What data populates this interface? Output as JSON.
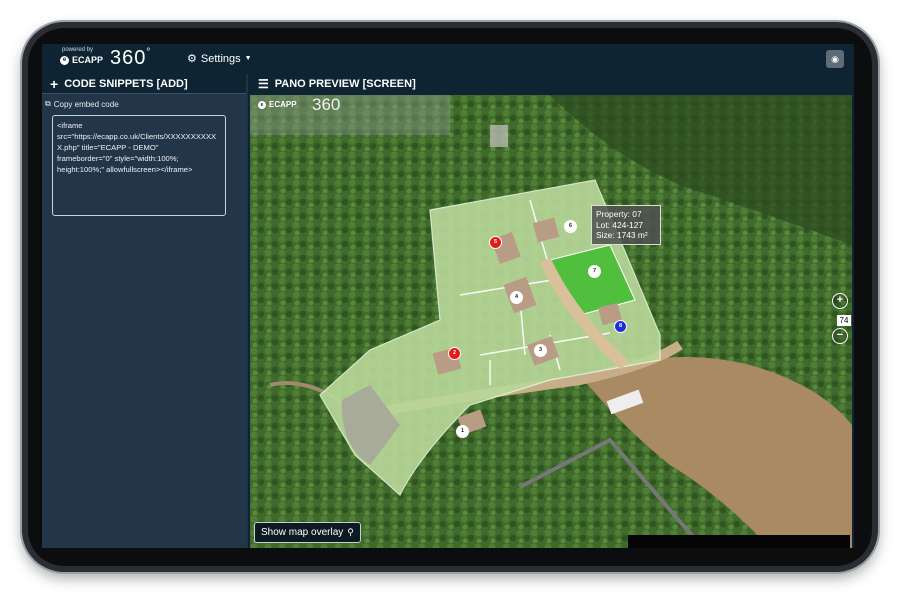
{
  "header": {
    "powered_by": "powered by",
    "brand": "ECAPP",
    "logo_text": "360",
    "logo_degree": "°",
    "settings_label": "Settings",
    "colors": {
      "bar": "#0e2433",
      "panel": "#233549"
    }
  },
  "left_panel": {
    "title": "CODE SNIPPETS [ADD]",
    "copy_label": "Copy embed code",
    "code": "<iframe\nsrc=\"https://ecapp.co.uk/Clients/XXXXXXXXXXX.php\" title=\"ECAPP - DEMO\"\nframeborder=\"0\" style=\"width:100%;\nheight:100%;\" allowfullscreen></iframe>"
  },
  "right_panel": {
    "title": "PANO PREVIEW [SCREEN]",
    "pano_brand": "ECAPP",
    "pano_logo": "360",
    "tooltip": {
      "property": "Property: 07",
      "lot": "Lot: 424-127",
      "size": "Size: 1743 m²"
    },
    "zoom_level": "74",
    "zoom_in": "+",
    "zoom_out": "−",
    "overlay_button": "Show map overlay",
    "markers": [
      {
        "label": "1",
        "color": "#ffffff"
      },
      {
        "label": "2",
        "color": "#e21b1b"
      },
      {
        "label": "3",
        "color": "#ffffff"
      },
      {
        "label": "4",
        "color": "#ffffff"
      },
      {
        "label": "5",
        "color": "#e21b1b"
      },
      {
        "label": "6",
        "color": "#ffffff"
      },
      {
        "label": "7",
        "color": "#ffffff"
      },
      {
        "label": "8",
        "color": "#1d2fd9"
      }
    ]
  }
}
